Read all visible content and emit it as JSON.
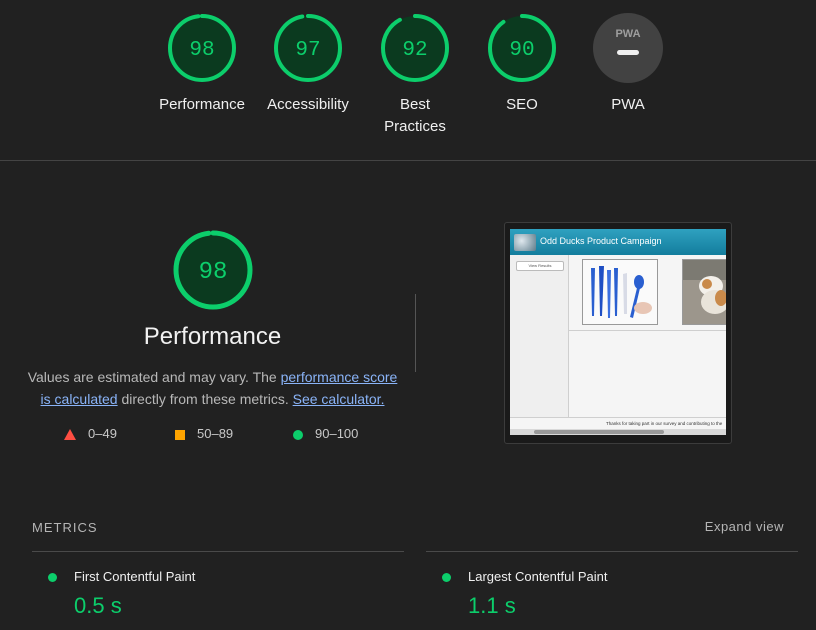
{
  "colors": {
    "pass": "#0cce6b",
    "average": "#ffa400",
    "fail": "#ff4e42",
    "gauge_bg": "#0b3a1f",
    "pwa_bg": "#424242"
  },
  "gauges": [
    {
      "score": "98",
      "label": "Performance"
    },
    {
      "score": "97",
      "label": "Accessibility"
    },
    {
      "score": "92",
      "label": "Best Practices"
    },
    {
      "score": "90",
      "label": "SEO"
    },
    {
      "label": "PWA",
      "badge": "PWA",
      "icon": "pwa-icon"
    }
  ],
  "performance": {
    "score": "98",
    "title": "Performance",
    "desc_prefix": "Values are estimated and may vary. The ",
    "desc_link1": "performance score is calculated",
    "desc_mid": " directly from these metrics. ",
    "desc_link2": "See calculator."
  },
  "legend": {
    "fail": "0–49",
    "average": "50–89",
    "pass": "90–100"
  },
  "screenshot": {
    "title": "Odd Ducks Product Campaign",
    "button": "View Results",
    "footer": "Thanks for taking part in our survey and contributing to the"
  },
  "metrics": {
    "title": "METRICS",
    "expand": "Expand view",
    "items": [
      {
        "name": "First Contentful Paint",
        "value": "0.5 s"
      },
      {
        "name": "Largest Contentful Paint",
        "value": "1.1 s"
      }
    ]
  }
}
